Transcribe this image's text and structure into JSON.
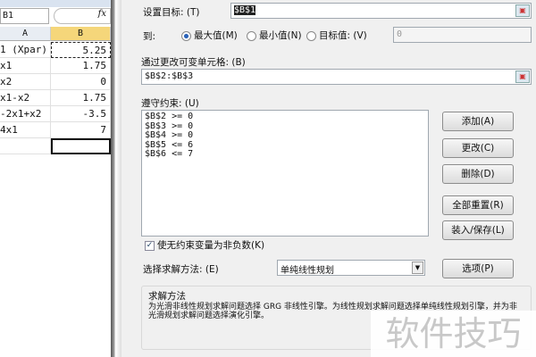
{
  "sheet": {
    "name_box": "B1",
    "fx_label": "fx",
    "columns": [
      "A",
      "B"
    ],
    "rows": [
      [
        "1 (Xpar)",
        "5.25"
      ],
      [
        "x1",
        "1.75"
      ],
      [
        "x2",
        "0"
      ],
      [
        "x1-x2",
        "1.75"
      ],
      [
        "-2x1+x2",
        "-3.5"
      ],
      [
        "4x1",
        "7"
      ],
      [
        "",
        ""
      ]
    ]
  },
  "dialog": {
    "target_label": "设置目标: (T)",
    "target_value": "$B$1",
    "to_label": "到:",
    "radios": [
      {
        "label": "最大值(M)",
        "checked": true
      },
      {
        "label": "最小值(N)",
        "checked": false
      },
      {
        "label": "目标值: (V)",
        "checked": false
      }
    ],
    "target_amount": "0",
    "changing_label": "通过更改可变单元格: (B)",
    "changing_value": "$B$2:$B$3",
    "constraints_label": "遵守约束: (U)",
    "constraints": [
      "$B$2 >= 0",
      "$B$3 >= 0",
      "$B$4 >= 0",
      "$B$5 <= 6",
      "$B$6 <= 7"
    ],
    "buttons": {
      "add": "添加(A)",
      "change": "更改(C)",
      "delete": "删除(D)",
      "reset": "全部重置(R)",
      "load_save": "装入/保存(L)",
      "options": "选项(P)"
    },
    "nonneg_label": "使无约束变量为非负数(K)",
    "nonneg_checked": true,
    "method_label": "选择求解方法: (E)",
    "method_value": "单纯线性规划",
    "group_title": "求解方法",
    "group_text": "为光滑非线性规划求解问题选择 GRG 非线性引擎。为线性规划求解问题选择单纯线性规划引擎，并为非光滑规划求解问题选择演化引擎。"
  },
  "watermark": "软件技巧"
}
